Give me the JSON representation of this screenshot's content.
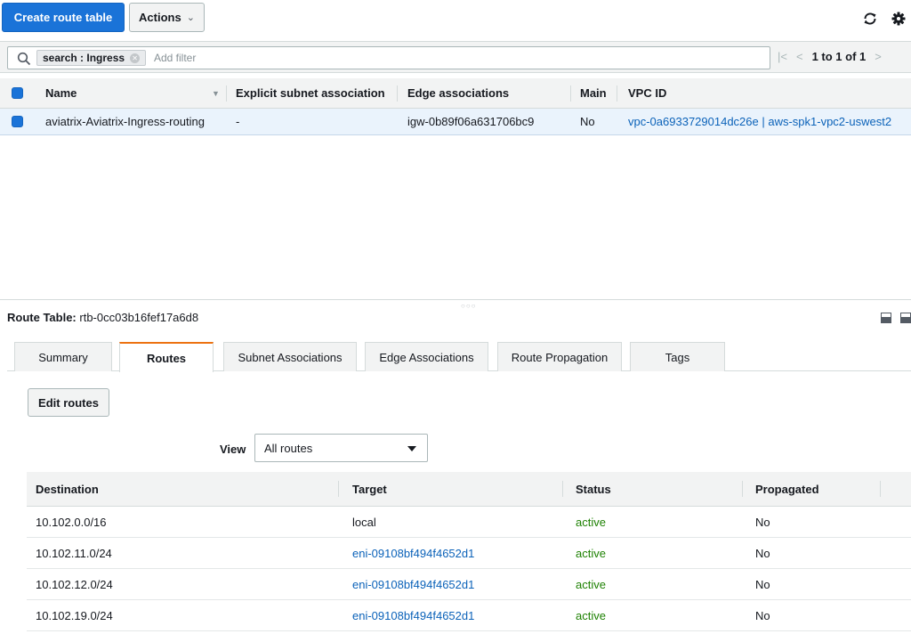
{
  "toolbar": {
    "create_label": "Create route table",
    "actions_label": "Actions",
    "refresh_icon": "refresh-icon",
    "settings_icon": "gear-icon"
  },
  "filter": {
    "token": "search : Ingress",
    "placeholder": "Add filter",
    "pagination": "1 to 1 of 1"
  },
  "route_tables": {
    "columns": [
      "Name",
      "Explicit subnet association",
      "Edge associations",
      "Main",
      "VPC ID"
    ],
    "rows": [
      {
        "name": "aviatrix-Aviatrix-Ingress-routing",
        "subnet": "-",
        "edge": "igw-0b89f06a631706bc9",
        "main": "No",
        "vpc": "vpc-0a6933729014dc26e | aws-spk1-vpc2-uswest2"
      }
    ]
  },
  "detail": {
    "title_label": "Route Table:",
    "title_value": "rtb-0cc03b16fef17a6d8",
    "tabs": [
      "Summary",
      "Routes",
      "Subnet Associations",
      "Edge Associations",
      "Route Propagation",
      "Tags"
    ],
    "active_tab": "Routes",
    "edit_label": "Edit routes",
    "view_label": "View",
    "view_value": "All routes"
  },
  "routes": {
    "columns": [
      "Destination",
      "Target",
      "Status",
      "Propagated"
    ],
    "rows": [
      {
        "destination": "10.102.0.0/16",
        "target": "local",
        "status": "active",
        "propagated": "No"
      },
      {
        "destination": "10.102.11.0/24",
        "target": "eni-09108bf494f4652d1",
        "status": "active",
        "propagated": "No"
      },
      {
        "destination": "10.102.12.0/24",
        "target": "eni-09108bf494f4652d1",
        "status": "active",
        "propagated": "No"
      },
      {
        "destination": "10.102.19.0/24",
        "target": "eni-09108bf494f4652d1",
        "status": "active",
        "propagated": "No"
      }
    ]
  },
  "colors": {
    "primary": "#1a73d8",
    "link": "#0b62b9",
    "active_status": "#1d8102",
    "tab_accent": "#ec7211",
    "selected_row": "#eaf3fc"
  }
}
